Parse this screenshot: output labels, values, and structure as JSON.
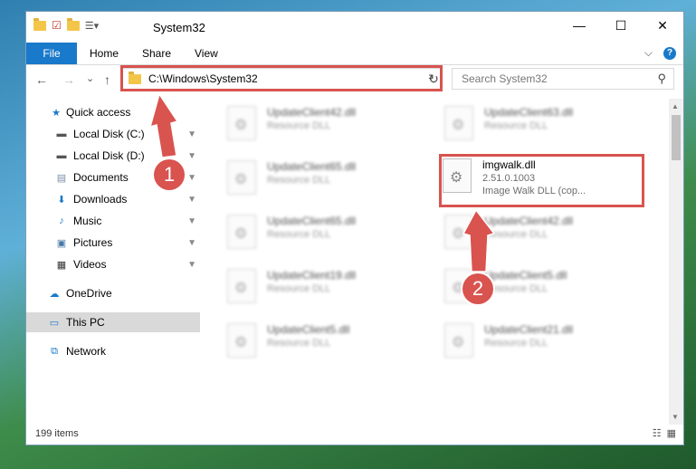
{
  "window": {
    "title": "System32",
    "tabs": [
      "File",
      "Home",
      "Share",
      "View"
    ],
    "min": "—",
    "max": "☐",
    "close": "✕",
    "help": "?",
    "expand": "⌵"
  },
  "navigation": {
    "back": "←",
    "forward": "→",
    "recent": "⌄",
    "up": "↑",
    "address": "C:\\Windows\\System32",
    "address_dropdown": "⌄",
    "refresh": "↻",
    "search_placeholder": "Search System32",
    "search_icon": "⚲"
  },
  "sidebar": {
    "items": [
      {
        "label": "Quick access",
        "icon": "star-icon"
      },
      {
        "label": "Local Disk (C:)",
        "icon": "drive-icon",
        "pinned": true
      },
      {
        "label": "Local Disk (D:)",
        "icon": "drive-icon",
        "pinned": true
      },
      {
        "label": "Documents",
        "icon": "documents-icon",
        "pinned": true
      },
      {
        "label": "Downloads",
        "icon": "downloads-icon",
        "pinned": true
      },
      {
        "label": "Music",
        "icon": "music-icon",
        "pinned": true
      },
      {
        "label": "Pictures",
        "icon": "pictures-icon",
        "pinned": true
      },
      {
        "label": "Videos",
        "icon": "videos-icon",
        "pinned": true
      },
      {
        "label": "OneDrive",
        "icon": "cloud-icon"
      },
      {
        "label": "This PC",
        "icon": "computer-icon",
        "selected": true
      },
      {
        "label": "Network",
        "icon": "network-icon"
      }
    ],
    "pin_glyph": "📌"
  },
  "files": [
    {
      "name": "UpdateClient42.dll",
      "sub": "Resource DLL",
      "blurred": true
    },
    {
      "name": "UpdateClient63.dll",
      "sub": "Resource DLL",
      "blurred": true
    },
    {
      "name": "UpdateClient65.dll",
      "sub": "Resource DLL",
      "blurred": true
    },
    {
      "name": "imgwalk.dll",
      "sub": "2.51.0.1003",
      "sub2": "Image Walk DLL (cop...",
      "blurred": false
    },
    {
      "name": "UpdateClient65.dll",
      "sub": "Resource DLL",
      "blurred": true
    },
    {
      "name": "UpdateClient42.dll",
      "sub": "Resource DLL",
      "blurred": true
    },
    {
      "name": "UpdateClient19.dll",
      "sub": "Resource DLL",
      "blurred": true
    },
    {
      "name": "UpdateClient5.dll",
      "sub": "Resource DLL",
      "blurred": true
    },
    {
      "name": "UpdateClient5.dll",
      "sub": "Resource DLL",
      "blurred": true
    },
    {
      "name": "UpdateClient21.dll",
      "sub": "Resource DLL",
      "blurred": true
    }
  ],
  "status": {
    "count": "199 items",
    "details_view": "☷",
    "tiles_view": "▦"
  },
  "annotations": {
    "step1": "1",
    "step2": "2",
    "color": "#d9534f"
  }
}
